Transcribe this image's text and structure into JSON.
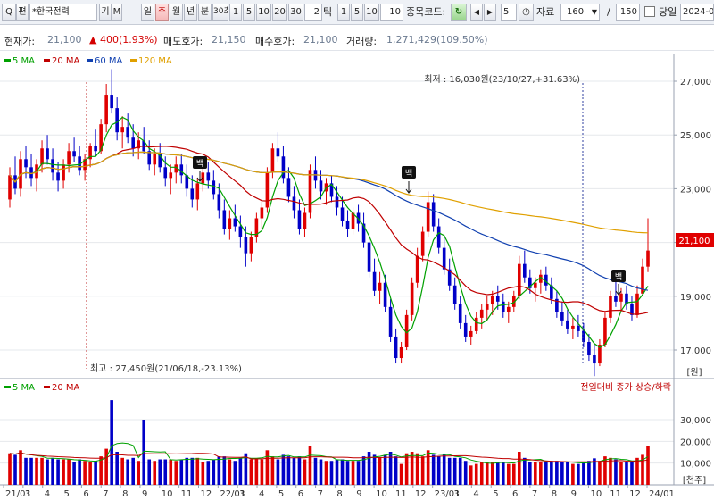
{
  "toolbar": {
    "q_button": "Q",
    "q_button_sub": "편",
    "stock_name": "*한국전력",
    "tab_gi": "기",
    "tab_m": "M",
    "periods": [
      "일",
      "주",
      "월",
      "년"
    ],
    "period_selected": "주",
    "minute_label": "분",
    "seconds_label": "30초",
    "minutes": [
      "1",
      "5",
      "10",
      "20",
      "30"
    ],
    "tick_value": "2",
    "tick_label": "틱",
    "ticks": [
      "1",
      "5",
      "10"
    ],
    "tick_input": "10",
    "stock_code_label": "종목코드:",
    "count_value": "5",
    "data_label": "자료",
    "data_count": "160",
    "total_count": "150",
    "today_label": "당일",
    "date_value": "2024-0"
  },
  "info": {
    "price_label": "현재가:",
    "price_value": "21,100",
    "change_value": "400(1.93%)",
    "ask_label": "매도호가:",
    "ask_value": "21,150",
    "bid_label": "매수호가:",
    "bid_value": "21,100",
    "volume_label": "거래량:",
    "volume_value": "1,271,429(109.50%)"
  },
  "colors": {
    "up": "#e00000",
    "down": "#0000c8",
    "ma5": "#00a000",
    "ma20": "#c00000",
    "ma60": "#1040b0",
    "ma120": "#e0a000",
    "current_price_badge": "#e00000"
  },
  "legend": {
    "price": [
      "5 MA",
      "20 MA",
      "60 MA",
      "120 MA"
    ],
    "volume": [
      "5 MA",
      "20 MA"
    ]
  },
  "annotations": {
    "high": "최저 : 16,030원(23/10/27,+31.63%)",
    "low": "최고 : 27,450원(21/06/18,-23.13%)",
    "volume_note": "전일대비 종가 상승/하락",
    "marker_label": "백"
  },
  "chart_data": {
    "type": "candlestick",
    "title": "",
    "price_ylim": [
      15500,
      28000
    ],
    "price_ticks": [
      "27,000",
      "25,000",
      "23,000",
      "21,000",
      "19,000",
      "17,000"
    ],
    "price_unit": "[원]",
    "current_price": "21,100",
    "volume_ylim": [
      0,
      40000
    ],
    "volume_ticks": [
      "30,000",
      "20,000",
      "10,000"
    ],
    "volume_unit": "[천주]",
    "x_tick_labels": [
      "21/01",
      "3",
      "4",
      "5",
      "6",
      "7",
      "8",
      "9",
      "10",
      "11",
      "12",
      "22/01",
      "3",
      "4",
      "5",
      "6",
      "7",
      "8",
      "9",
      "10",
      "11",
      "12",
      "23/01",
      "3",
      "4",
      "5",
      "6",
      "7",
      "8",
      "9",
      "10",
      "11",
      "12",
      "24/01"
    ],
    "candles": [
      [
        22600,
        23800,
        22300,
        23500
      ],
      [
        23500,
        24200,
        22800,
        23000
      ],
      [
        23000,
        24400,
        22700,
        24100
      ],
      [
        24100,
        24600,
        23400,
        23800
      ],
      [
        23800,
        24300,
        23100,
        23400
      ],
      [
        23400,
        24100,
        22900,
        23900
      ],
      [
        23900,
        24800,
        23600,
        24500
      ],
      [
        24500,
        25000,
        23900,
        24100
      ],
      [
        24100,
        24500,
        23300,
        23600
      ],
      [
        23600,
        24000,
        22900,
        23300
      ],
      [
        23300,
        24100,
        23000,
        23900
      ],
      [
        23900,
        24700,
        23600,
        24400
      ],
      [
        24400,
        24900,
        24000,
        24200
      ],
      [
        24200,
        24600,
        23500,
        23700
      ],
      [
        23700,
        24300,
        23300,
        24100
      ],
      [
        24100,
        24700,
        23800,
        24600
      ],
      [
        24600,
        25200,
        24200,
        24400
      ],
      [
        24400,
        25600,
        24300,
        25400
      ],
      [
        25400,
        26900,
        25100,
        26500
      ],
      [
        26500,
        27450,
        25800,
        26000
      ],
      [
        26000,
        26400,
        24800,
        25100
      ],
      [
        25100,
        25700,
        24500,
        25300
      ],
      [
        25300,
        25800,
        24700,
        24900
      ],
      [
        24900,
        25400,
        24200,
        24500
      ],
      [
        24500,
        25100,
        24100,
        24800
      ],
      [
        24800,
        25300,
        24300,
        24400
      ],
      [
        24400,
        24800,
        23700,
        23900
      ],
      [
        23900,
        24500,
        23500,
        24300
      ],
      [
        24300,
        24700,
        23600,
        23800
      ],
      [
        23800,
        24200,
        23100,
        23400
      ],
      [
        23400,
        23900,
        22800,
        23600
      ],
      [
        23600,
        24200,
        23200,
        23900
      ],
      [
        23900,
        24300,
        23200,
        23500
      ],
      [
        23500,
        23900,
        22700,
        23000
      ],
      [
        23000,
        23500,
        22300,
        22600
      ],
      [
        22600,
        23400,
        22200,
        23200
      ],
      [
        23200,
        23800,
        22900,
        23600
      ],
      [
        23600,
        24000,
        23000,
        23300
      ],
      [
        23300,
        23700,
        22600,
        22800
      ],
      [
        22800,
        23200,
        21900,
        22200
      ],
      [
        22200,
        22600,
        21300,
        21500
      ],
      [
        21500,
        22200,
        21100,
        21900
      ],
      [
        21900,
        22400,
        21400,
        21600
      ],
      [
        21600,
        22000,
        20800,
        21200
      ],
      [
        21200,
        21600,
        20100,
        20600
      ],
      [
        20600,
        21400,
        20300,
        21200
      ],
      [
        21200,
        22100,
        21000,
        21900
      ],
      [
        21900,
        22600,
        21500,
        22300
      ],
      [
        22300,
        23800,
        22100,
        23600
      ],
      [
        23600,
        24700,
        23400,
        24500
      ],
      [
        24500,
        25100,
        24000,
        24200
      ],
      [
        24200,
        24600,
        23200,
        23400
      ],
      [
        23400,
        23800,
        22500,
        22700
      ],
      [
        22700,
        23100,
        21900,
        22200
      ],
      [
        22200,
        22600,
        21300,
        21500
      ],
      [
        21500,
        22300,
        21200,
        22100
      ],
      [
        22100,
        23900,
        21900,
        23700
      ],
      [
        23700,
        24200,
        23000,
        23300
      ],
      [
        23300,
        23700,
        22600,
        22900
      ],
      [
        22900,
        23400,
        22400,
        23200
      ],
      [
        23200,
        23500,
        22500,
        22700
      ],
      [
        22700,
        23100,
        22000,
        22300
      ],
      [
        22300,
        22700,
        21600,
        21800
      ],
      [
        21800,
        22200,
        21200,
        21500
      ],
      [
        21500,
        22300,
        21300,
        22100
      ],
      [
        22100,
        22400,
        21400,
        21700
      ],
      [
        21700,
        22100,
        20800,
        21000
      ],
      [
        21000,
        21300,
        19700,
        19900
      ],
      [
        19900,
        20400,
        19000,
        19200
      ],
      [
        19200,
        19900,
        18700,
        19500
      ],
      [
        19500,
        19800,
        18400,
        18600
      ],
      [
        18600,
        18900,
        17300,
        17500
      ],
      [
        17500,
        17800,
        16500,
        16700
      ],
      [
        16700,
        17300,
        16500,
        17100
      ],
      [
        17100,
        18500,
        17000,
        18300
      ],
      [
        18300,
        19700,
        18100,
        19500
      ],
      [
        19500,
        20800,
        19300,
        20500
      ],
      [
        20500,
        21600,
        20300,
        21400
      ],
      [
        21400,
        22900,
        21200,
        22500
      ],
      [
        22500,
        22800,
        21400,
        21600
      ],
      [
        21600,
        21900,
        20600,
        20800
      ],
      [
        20800,
        21200,
        19800,
        20000
      ],
      [
        20000,
        20400,
        19200,
        19400
      ],
      [
        19400,
        19700,
        18500,
        18700
      ],
      [
        18700,
        19000,
        17800,
        18000
      ],
      [
        18000,
        18300,
        17300,
        17500
      ],
      [
        17500,
        17900,
        17200,
        17700
      ],
      [
        17700,
        18400,
        17600,
        18200
      ],
      [
        18200,
        18700,
        17800,
        18500
      ],
      [
        18500,
        19000,
        18100,
        18700
      ],
      [
        18700,
        19200,
        18300,
        19000
      ],
      [
        19000,
        19400,
        18500,
        18800
      ],
      [
        18800,
        19100,
        18200,
        18400
      ],
      [
        18400,
        18800,
        18000,
        18600
      ],
      [
        18600,
        19200,
        18400,
        19000
      ],
      [
        19000,
        20500,
        18900,
        20200
      ],
      [
        20200,
        20700,
        19500,
        19700
      ],
      [
        19700,
        20000,
        19100,
        19300
      ],
      [
        19300,
        19700,
        18800,
        19500
      ],
      [
        19500,
        20000,
        19100,
        19800
      ],
      [
        19800,
        20100,
        19200,
        19400
      ],
      [
        19400,
        19700,
        18700,
        18900
      ],
      [
        18900,
        19200,
        18200,
        18400
      ],
      [
        18400,
        18800,
        17900,
        18100
      ],
      [
        18100,
        18500,
        17600,
        17800
      ],
      [
        17800,
        18200,
        17400,
        17900
      ],
      [
        17900,
        18300,
        17500,
        17700
      ],
      [
        17700,
        18000,
        17100,
        17300
      ],
      [
        17300,
        17600,
        16600,
        16800
      ],
      [
        16800,
        17200,
        16030,
        16500
      ],
      [
        16500,
        17400,
        16400,
        17200
      ],
      [
        17200,
        18400,
        17100,
        18200
      ],
      [
        18200,
        19200,
        18000,
        19000
      ],
      [
        19000,
        19700,
        18600,
        18800
      ],
      [
        18800,
        19300,
        18400,
        19100
      ],
      [
        19100,
        19400,
        18500,
        18700
      ],
      [
        18700,
        19000,
        18100,
        18300
      ],
      [
        18300,
        19400,
        18200,
        19100
      ],
      [
        19100,
        20400,
        19000,
        20100
      ],
      [
        20100,
        21900,
        19900,
        20700
      ]
    ]
  }
}
